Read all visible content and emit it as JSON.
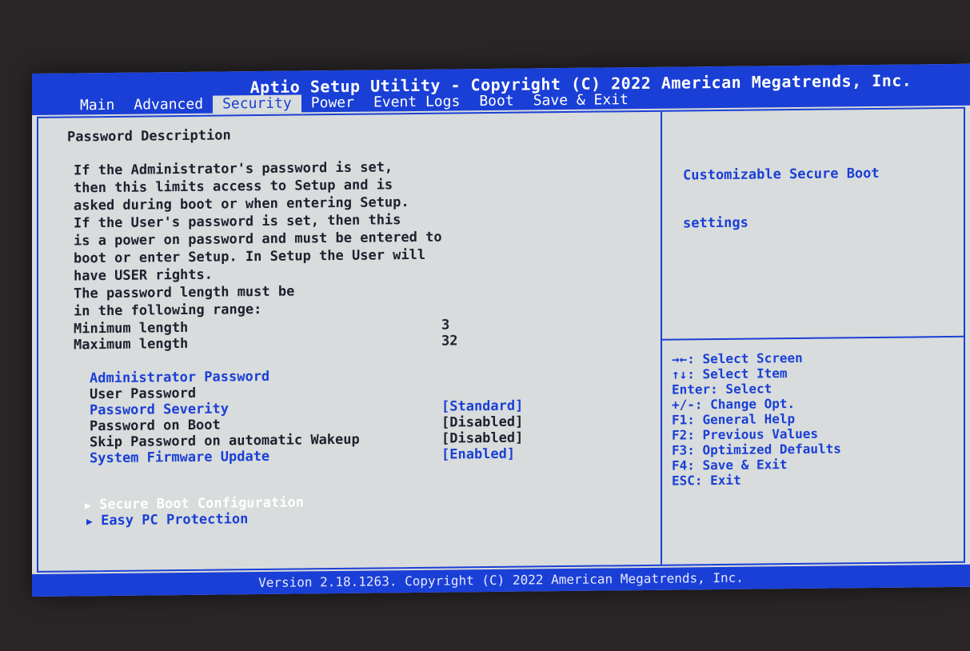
{
  "title": "Aptio Setup Utility - Copyright (C) 2022 American Megatrends, Inc.",
  "tabs": [
    {
      "label": "Main"
    },
    {
      "label": "Advanced"
    },
    {
      "label": "Security"
    },
    {
      "label": "Power"
    },
    {
      "label": "Event Logs"
    },
    {
      "label": "Boot"
    },
    {
      "label": "Save & Exit"
    }
  ],
  "active_tab": "Security",
  "description": {
    "heading": "Password Description",
    "lines": [
      "If the Administrator's password is set,",
      "then this limits access to Setup and is",
      "asked during boot or when entering Setup.",
      "If the User's password is set, then this",
      "is a power on password and must be entered to",
      "boot or enter Setup. In Setup the User will",
      "have USER rights.",
      "The password length must be",
      "in the following range:"
    ],
    "min_label": "Minimum length",
    "min_value": "3",
    "max_label": "Maximum length",
    "max_value": "32"
  },
  "settings": {
    "admin_password": "Administrator Password",
    "user_password": "User Password",
    "password_severity": {
      "label": "Password Severity",
      "value": "[Standard]"
    },
    "password_on_boot": {
      "label": "Password on Boot",
      "value": "[Disabled]"
    },
    "skip_password_wakeup": {
      "label": "Skip Password on automatic Wakeup",
      "value": "[Disabled]"
    },
    "system_firmware_update": {
      "label": "System Firmware Update",
      "value": "[Enabled]"
    }
  },
  "submenus": [
    {
      "label": "Secure Boot Configuration"
    },
    {
      "label": "Easy PC Protection"
    }
  ],
  "help": {
    "text_line1": "Customizable Secure Boot",
    "text_line2": "settings"
  },
  "keys": [
    "→←: Select Screen",
    "↑↓: Select Item",
    "Enter: Select",
    "+/-: Change Opt.",
    "F1: General Help",
    "F2: Previous Values",
    "F3: Optimized Defaults",
    "F4: Save & Exit",
    "ESC: Exit"
  ],
  "footer": "Version 2.18.1263. Copyright (C) 2022 American Megatrends, Inc.",
  "colors": {
    "bios_blue": "#1a3fd6",
    "panel_bg": "#d8dcdc",
    "text_dark": "#1f1f2e"
  }
}
